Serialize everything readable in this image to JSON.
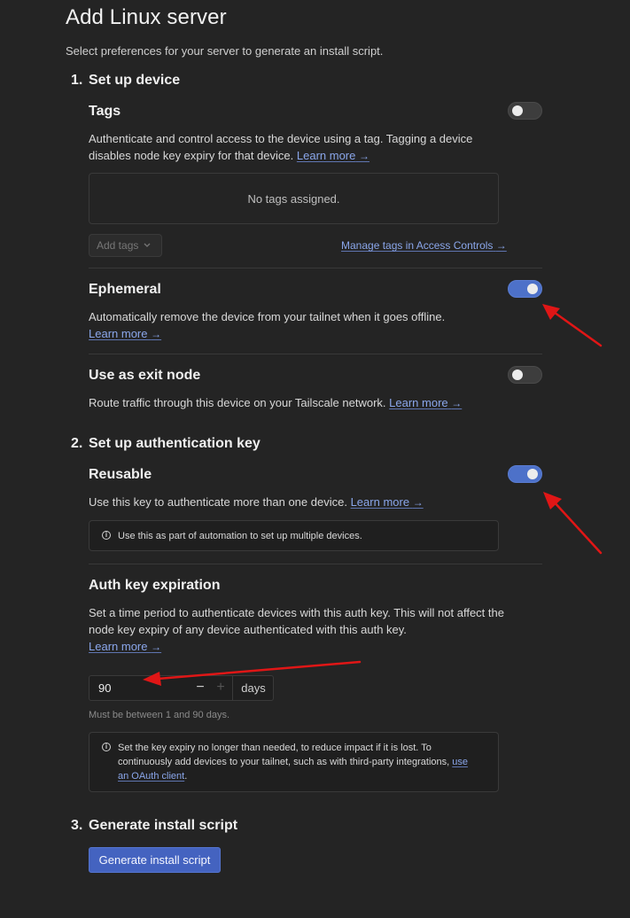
{
  "page": {
    "title": "Add Linux server",
    "subtitle": "Select preferences for your server to generate an install script."
  },
  "steps": [
    {
      "number": "1.",
      "title": "Set up device"
    },
    {
      "number": "2.",
      "title": "Set up authentication key"
    },
    {
      "number": "3.",
      "title": "Generate install script"
    }
  ],
  "tags": {
    "title": "Tags",
    "enabled": false,
    "description": "Authenticate and control access to the device using a tag. Tagging a device disables node key expiry for that device.",
    "learn_more": "Learn more",
    "empty_text": "No tags assigned.",
    "add_tags_label": "Add tags",
    "manage_link": "Manage tags in Access Controls"
  },
  "ephemeral": {
    "title": "Ephemeral",
    "enabled": true,
    "description": "Automatically remove the device from your tailnet when it goes offline.",
    "learn_more": "Learn more"
  },
  "exit_node": {
    "title": "Use as exit node",
    "enabled": false,
    "description": "Route traffic through this device on your Tailscale network.",
    "learn_more": "Learn more"
  },
  "reusable": {
    "title": "Reusable",
    "enabled": true,
    "description": "Use this key to authenticate more than one device.",
    "learn_more": "Learn more",
    "info": "Use this as part of automation to set up multiple devices."
  },
  "expiration": {
    "title": "Auth key expiration",
    "description": "Set a time period to authenticate devices with this auth key. This will not affect the node key expiry of any device authenticated with this auth key.",
    "learn_more": "Learn more",
    "value": "90",
    "unit": "days",
    "hint": "Must be between 1 and 90 days.",
    "info_prefix": "Set the key expiry no longer than needed, to reduce impact if it is lost. To continuously add devices to your tailnet, such as with third-party integrations,",
    "info_link": "use an OAuth client",
    "info_suffix": "."
  },
  "generate": {
    "button_label": "Generate install script"
  },
  "icons": {
    "arrow": "→",
    "chevron": "chevron-down-icon",
    "info": "info-icon"
  },
  "colors": {
    "background": "#242424",
    "accent": "#4d71c9",
    "link": "#8aa6ea",
    "annotation": "#e01616"
  }
}
